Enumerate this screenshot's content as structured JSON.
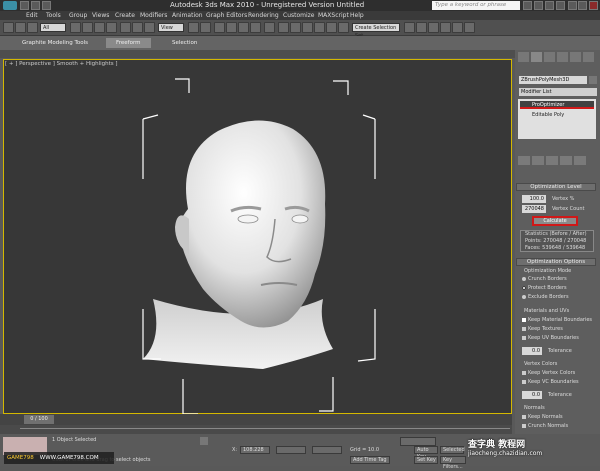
{
  "title": "Autodesk 3ds Max  2010   -  Unregistered Version  Untitled",
  "search_placeholder": "Type a keyword or phrase",
  "menu": [
    "Edit",
    "Tools",
    "Group",
    "Views",
    "Create",
    "Modifiers",
    "Animation",
    "Graph Editors",
    "Rendering",
    "Customize",
    "MAXScript",
    "Help"
  ],
  "toolbar": {
    "selection_filter": "All",
    "ref_coord": "View",
    "named_selection": "Create Selection Set"
  },
  "ribbon_tabs": [
    "Graphite Modeling Tools",
    "Freeform",
    "Selection"
  ],
  "viewport_label": "[ + ] Perspective ] Smooth + Highlights ]",
  "command_panel": {
    "object_name": "ZBrushPolyMesh3D",
    "modifier_list": "Modifier List",
    "stack": [
      "ProOptimizer",
      "Editable Poly"
    ],
    "rollouts": {
      "level": "Optimization Level",
      "vertex_pct_value": "100.0",
      "vertex_pct_label": "Vertex %",
      "vertex_count_value": "270048",
      "vertex_count_label": "Vertex Count",
      "calculate": "Calculate",
      "stats_title": "Statistics (Before / After)",
      "stats_points": "Points: 270048 / 270048",
      "stats_faces": "Faces: 539648 / 539648",
      "options": "Optimization Options",
      "mode_group": "Optimization Mode",
      "mode_options": [
        "Crunch Borders",
        "Protect Borders",
        "Exclude Borders"
      ],
      "uvs_group": "Materials and UVs",
      "uv_options": [
        "Keep Material Boundaries",
        "Keep Textures",
        "Keep UV Boundaries"
      ],
      "tolerance": "Tolerance",
      "tolerance_value": "0.0",
      "vcolors_group": "Vertex Colors",
      "vc_options": [
        "Keep Vertex Colors",
        "Keep VC Boundaries"
      ],
      "normals_group": "Normals",
      "normals_options": [
        "Keep Normals",
        "Crunch Normals"
      ]
    }
  },
  "timeline": {
    "frame": "0 / 100"
  },
  "status": {
    "selected": "1 Object Selected",
    "prompt": "Click or click-and-drag to select objects",
    "x_label": "X:",
    "x_value": "108.228",
    "grid": "Grid = 10.0",
    "auto_key": "Auto Key",
    "selected_dd": "Selected",
    "set_key": "Set Key",
    "key_filters": "Key Filters...",
    "add_time_tag": "Add Time Tag"
  },
  "watermark": {
    "site1": "GAME798",
    "site1_url": "WWW.GAME798.COM",
    "site2": "查字典 教程网",
    "site2_url": "jiaocheng.chazidian.com"
  },
  "colors": {
    "highlight_red": "#d01818",
    "accent_yellow": "#d4b800"
  }
}
